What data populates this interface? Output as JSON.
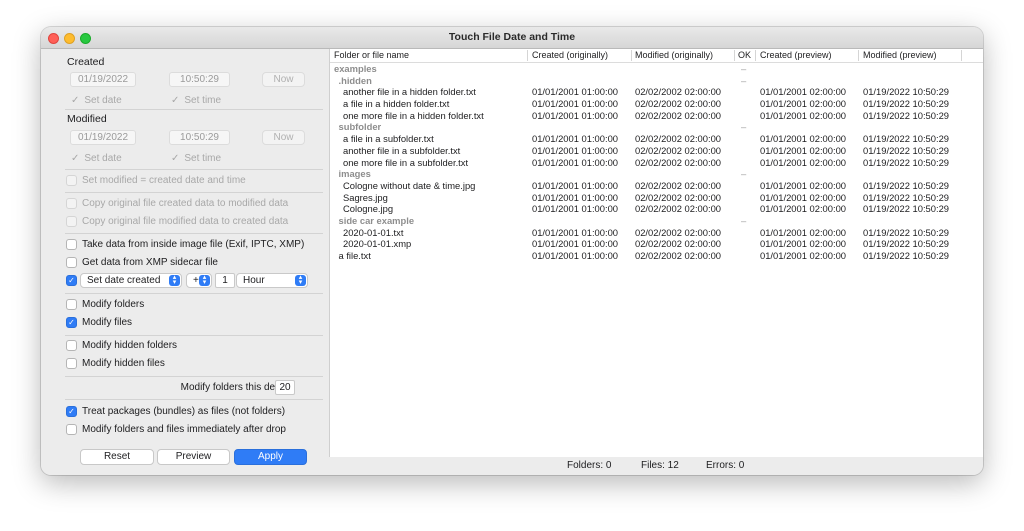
{
  "window": {
    "title": "Touch File Date and Time"
  },
  "created": {
    "label": "Created",
    "date": "01/19/2022",
    "time": "10:50:29",
    "now_label": "Now",
    "set_date_label": "Set date",
    "set_time_label": "Set time"
  },
  "modified": {
    "label": "Modified",
    "date": "01/19/2022",
    "time": "10:50:29",
    "now_label": "Now",
    "set_date_label": "Set date",
    "set_time_label": "Set time"
  },
  "options": {
    "set_modified_equals_created": "Set modified = created date and time",
    "copy_created_to_modified": "Copy original file created data to modified data",
    "copy_modified_to_created": "Copy original file modified data to created data",
    "take_from_image": "Take data from inside image file (Exif, IPTC, XMP)",
    "get_from_xmp": "Get data from XMP sidecar file",
    "set_date_created_popup": "Set date created",
    "plus_minus": "+",
    "offset_value": "1",
    "offset_unit": "Hour",
    "modify_folders": "Modify folders",
    "modify_files": "Modify files",
    "modify_hidden_folders": "Modify hidden folders",
    "modify_hidden_files": "Modify hidden files",
    "depth_label": "Modify folders this deep:",
    "depth_value": "20",
    "treat_packages": "Treat packages (bundles) as files (not folders)",
    "modify_after_drop": "Modify folders and files immediately after drop"
  },
  "buttons": {
    "reset": "Reset",
    "preview": "Preview",
    "apply": "Apply"
  },
  "table": {
    "headers": [
      "Folder or file name",
      "Created (originally)",
      "Modified (originally)",
      "OK",
      "Created (preview)",
      "Modified (preview)"
    ],
    "rows": [
      {
        "type": "folder",
        "indent": 0,
        "name": "examples",
        "c_orig": "",
        "m_orig": "",
        "ok": "–",
        "c_prev": "",
        "m_prev": ""
      },
      {
        "type": "folder",
        "indent": 1,
        "name": ".hidden",
        "c_orig": "",
        "m_orig": "",
        "ok": "–",
        "c_prev": "",
        "m_prev": ""
      },
      {
        "type": "file",
        "indent": 2,
        "name": "another file in a hidden folder.txt",
        "c_orig": "01/01/2001  01:00:00",
        "m_orig": "02/02/2002  02:00:00",
        "ok": "",
        "c_prev": "01/01/2001  02:00:00",
        "m_prev": "01/19/2022  10:50:29"
      },
      {
        "type": "file",
        "indent": 2,
        "name": "a file in a hidden folder.txt",
        "c_orig": "01/01/2001  01:00:00",
        "m_orig": "02/02/2002  02:00:00",
        "ok": "",
        "c_prev": "01/01/2001  02:00:00",
        "m_prev": "01/19/2022  10:50:29"
      },
      {
        "type": "file",
        "indent": 2,
        "name": "one more file in a hidden folder.txt",
        "c_orig": "01/01/2001  01:00:00",
        "m_orig": "02/02/2002  02:00:00",
        "ok": "",
        "c_prev": "01/01/2001  02:00:00",
        "m_prev": "01/19/2022  10:50:29"
      },
      {
        "type": "folder",
        "indent": 1,
        "name": "subfolder",
        "c_orig": "",
        "m_orig": "",
        "ok": "–",
        "c_prev": "",
        "m_prev": ""
      },
      {
        "type": "file",
        "indent": 2,
        "name": "a file in a subfolder.txt",
        "c_orig": "01/01/2001  01:00:00",
        "m_orig": "02/02/2002  02:00:00",
        "ok": "",
        "c_prev": "01/01/2001  02:00:00",
        "m_prev": "01/19/2022  10:50:29"
      },
      {
        "type": "file",
        "indent": 2,
        "name": "another file in a subfolder.txt",
        "c_orig": "01/01/2001  01:00:00",
        "m_orig": "02/02/2002  02:00:00",
        "ok": "",
        "c_prev": "01/01/2001  02:00:00",
        "m_prev": "01/19/2022  10:50:29"
      },
      {
        "type": "file",
        "indent": 2,
        "name": "one more file in a subfolder.txt",
        "c_orig": "01/01/2001  01:00:00",
        "m_orig": "02/02/2002  02:00:00",
        "ok": "",
        "c_prev": "01/01/2001  02:00:00",
        "m_prev": "01/19/2022  10:50:29"
      },
      {
        "type": "folder",
        "indent": 1,
        "name": "images",
        "c_orig": "",
        "m_orig": "",
        "ok": "–",
        "c_prev": "",
        "m_prev": ""
      },
      {
        "type": "file",
        "indent": 2,
        "name": "Cologne without date & time.jpg",
        "c_orig": "01/01/2001  01:00:00",
        "m_orig": "02/02/2002  02:00:00",
        "ok": "",
        "c_prev": "01/01/2001  02:00:00",
        "m_prev": "01/19/2022  10:50:29"
      },
      {
        "type": "file",
        "indent": 2,
        "name": "Sagres.jpg",
        "c_orig": "01/01/2001  01:00:00",
        "m_orig": "02/02/2002  02:00:00",
        "ok": "",
        "c_prev": "01/01/2001  02:00:00",
        "m_prev": "01/19/2022  10:50:29"
      },
      {
        "type": "file",
        "indent": 2,
        "name": "Cologne.jpg",
        "c_orig": "01/01/2001  01:00:00",
        "m_orig": "02/02/2002  02:00:00",
        "ok": "",
        "c_prev": "01/01/2001  02:00:00",
        "m_prev": "01/19/2022  10:50:29"
      },
      {
        "type": "folder",
        "indent": 1,
        "name": "side car example",
        "c_orig": "",
        "m_orig": "",
        "ok": "–",
        "c_prev": "",
        "m_prev": ""
      },
      {
        "type": "file",
        "indent": 2,
        "name": "2020-01-01.txt",
        "c_orig": "01/01/2001  01:00:00",
        "m_orig": "02/02/2002  02:00:00",
        "ok": "",
        "c_prev": "01/01/2001  02:00:00",
        "m_prev": "01/19/2022  10:50:29"
      },
      {
        "type": "file",
        "indent": 2,
        "name": "2020-01-01.xmp",
        "c_orig": "01/01/2001  01:00:00",
        "m_orig": "02/02/2002  02:00:00",
        "ok": "",
        "c_prev": "01/01/2001  02:00:00",
        "m_prev": "01/19/2022  10:50:29"
      },
      {
        "type": "file",
        "indent": 1,
        "name": "a file.txt",
        "c_orig": "01/01/2001  01:00:00",
        "m_orig": "02/02/2002  02:00:00",
        "ok": "",
        "c_prev": "01/01/2001  02:00:00",
        "m_prev": "01/19/2022  10:50:29"
      }
    ]
  },
  "status": {
    "folders": "Folders:  0",
    "files": "Files: 12",
    "errors": "Errors: 0"
  },
  "colors": {
    "accent": "#2f7cf6",
    "folder_text": "#8e8e8e",
    "disabled_text": "#a8a8a8"
  }
}
